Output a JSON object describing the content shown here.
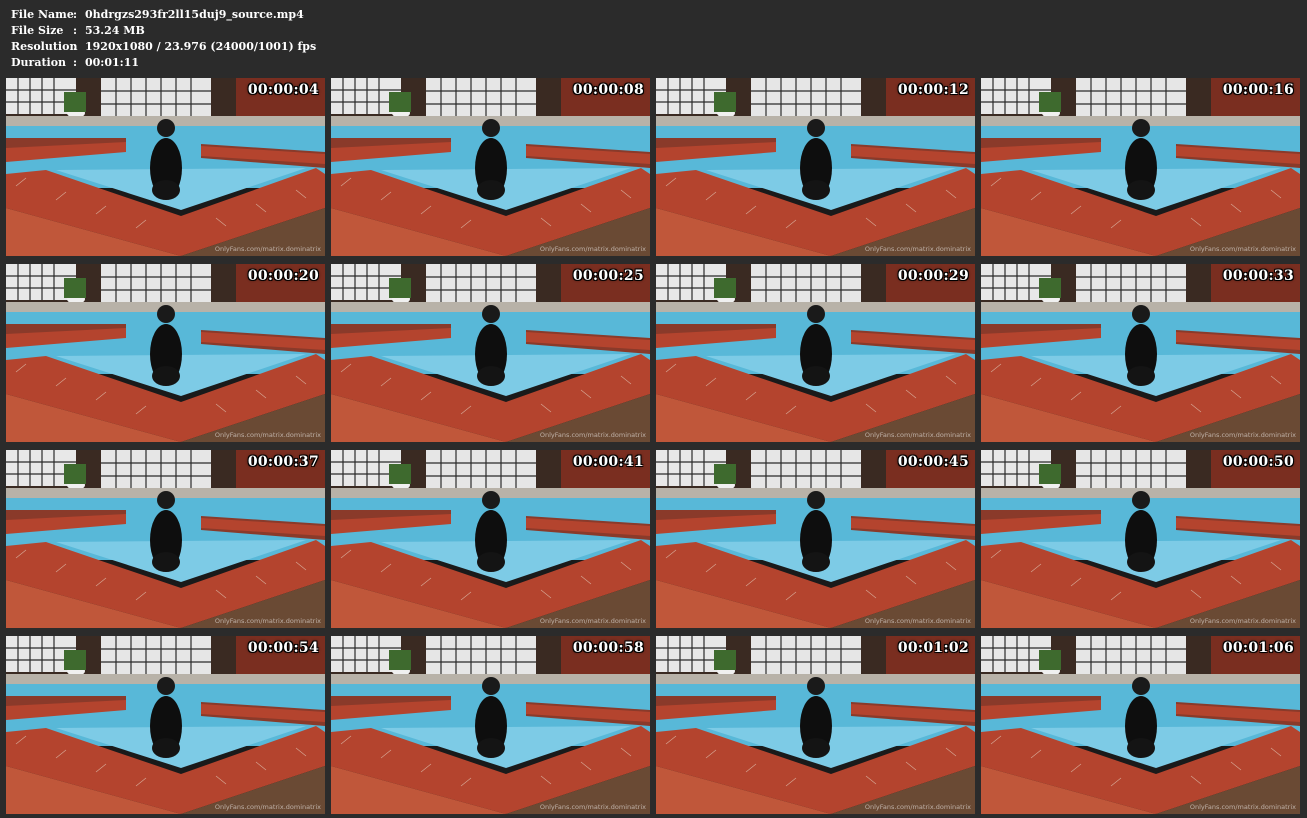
{
  "file_info": [
    {
      "key": "File Name",
      "sep": ":",
      "value": "0hdrgzs293fr2ll15duj9_source.mp4"
    },
    {
      "key": "File Size",
      "sep": ":",
      "value": "53.24 MB"
    },
    {
      "key": "Resolution",
      "sep": ":",
      "value": "1920x1080 / 23.976 (24000/1001) fps"
    },
    {
      "key": "Duration",
      "sep": ":",
      "value": "00:01:11"
    }
  ],
  "thumbnails": [
    {
      "timestamp": "00:00:04",
      "watermark": "OnlyFans.com/matrix.dominatrix"
    },
    {
      "timestamp": "00:00:08",
      "watermark": "OnlyFans.com/matrix.dominatrix"
    },
    {
      "timestamp": "00:00:12",
      "watermark": "OnlyFans.com/matrix.dominatrix"
    },
    {
      "timestamp": "00:00:16",
      "watermark": "OnlyFans.com/matrix.dominatrix"
    },
    {
      "timestamp": "00:00:20",
      "watermark": "OnlyFans.com/matrix.dominatrix"
    },
    {
      "timestamp": "00:00:25",
      "watermark": "OnlyFans.com/matrix.dominatrix"
    },
    {
      "timestamp": "00:00:29",
      "watermark": "OnlyFans.com/matrix.dominatrix"
    },
    {
      "timestamp": "00:00:33",
      "watermark": "OnlyFans.com/matrix.dominatrix"
    },
    {
      "timestamp": "00:00:37",
      "watermark": "OnlyFans.com/matrix.dominatrix"
    },
    {
      "timestamp": "00:00:41",
      "watermark": "OnlyFans.com/matrix.dominatrix"
    },
    {
      "timestamp": "00:00:45",
      "watermark": "OnlyFans.com/matrix.dominatrix"
    },
    {
      "timestamp": "00:00:50",
      "watermark": "OnlyFans.com/matrix.dominatrix"
    },
    {
      "timestamp": "00:00:54",
      "watermark": "OnlyFans.com/matrix.dominatrix"
    },
    {
      "timestamp": "00:00:58",
      "watermark": "OnlyFans.com/matrix.dominatrix"
    },
    {
      "timestamp": "00:01:02",
      "watermark": "OnlyFans.com/matrix.dominatrix"
    },
    {
      "timestamp": "00:01:06",
      "watermark": "OnlyFans.com/matrix.dominatrix"
    }
  ],
  "colors": {
    "background": "#2b2b2b",
    "text": "#ffffff",
    "pool_water": "#58b8d8",
    "brick": "#b4442e",
    "deck": "#c0573a"
  }
}
